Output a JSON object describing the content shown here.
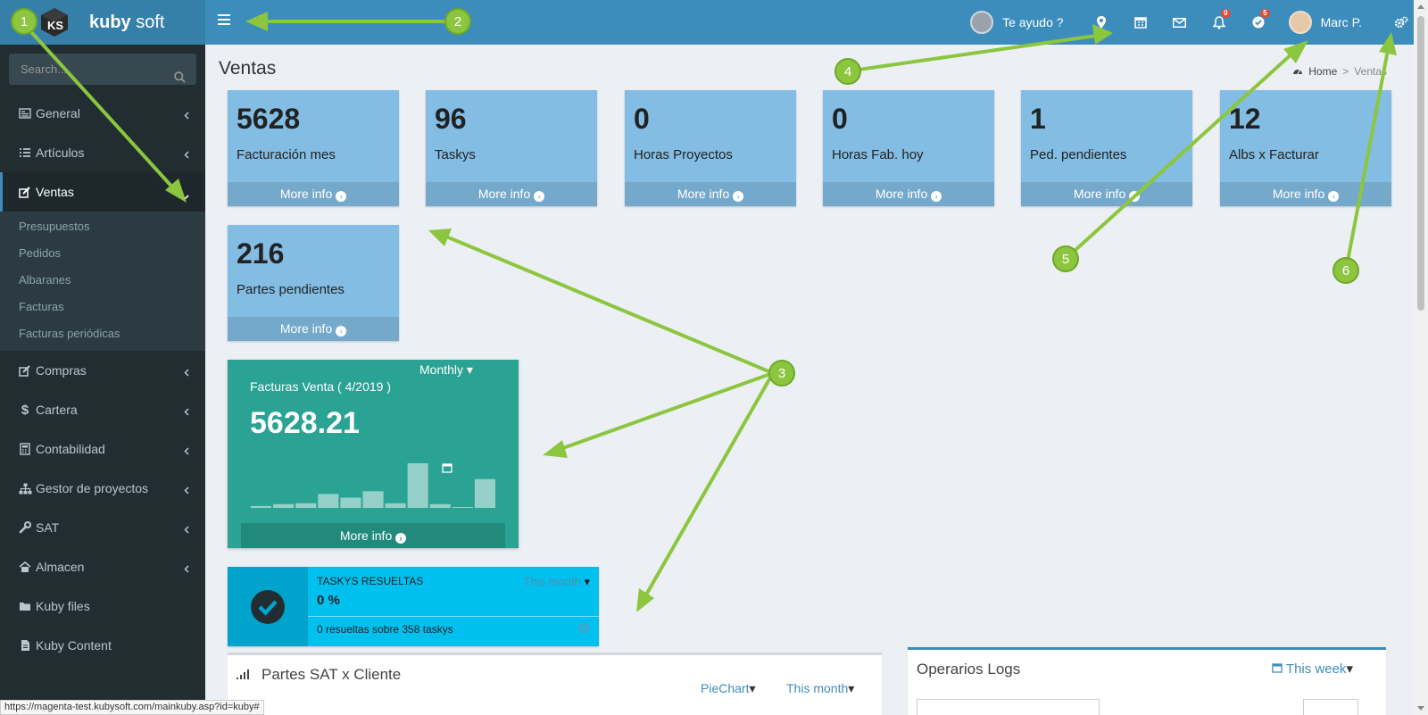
{
  "brand": {
    "name_bold": "kuby",
    "name_light": " soft",
    "logo_text": "KS"
  },
  "header": {
    "help_label": "Te ayudo ?",
    "notifications_badge": "0",
    "tasks_badge": "5",
    "user_name": "Marc P.",
    "icons": [
      "map-marker-icon",
      "calendar-icon",
      "envelope-icon",
      "bell-icon",
      "check-circle-icon",
      "gears-icon"
    ]
  },
  "sidebar": {
    "search_placeholder": "Search...",
    "items": [
      {
        "label": "General",
        "icon": "newspaper-icon"
      },
      {
        "label": "Artículos",
        "icon": "list-icon"
      },
      {
        "label": "Ventas",
        "icon": "edit-icon",
        "active": true
      },
      {
        "label": "Compras",
        "icon": "edit-icon"
      },
      {
        "label": "Cartera",
        "icon": "dollar-icon"
      },
      {
        "label": "Contabilidad",
        "icon": "calculator-icon"
      },
      {
        "label": "Gestor de proyectos",
        "icon": "sitemap-icon"
      },
      {
        "label": "SAT",
        "icon": "wrench-icon"
      },
      {
        "label": "Almacen",
        "icon": "home-icon"
      },
      {
        "label": "Kuby files",
        "icon": "folder-icon"
      },
      {
        "label": "Kuby Content",
        "icon": "file-icon"
      }
    ],
    "ventas_sub": [
      "Presupuestos",
      "Pedidos",
      "Albaranes",
      "Facturas",
      "Facturas periódicas"
    ]
  },
  "page": {
    "title": "Ventas",
    "breadcrumb_home": "Home",
    "breadcrumb_sep": ">",
    "breadcrumb_current": "Ventas"
  },
  "tiles": [
    {
      "value": "5628",
      "label": "Facturación mes",
      "more": "More info"
    },
    {
      "value": "96",
      "label": "Taskys",
      "more": "More info"
    },
    {
      "value": "0",
      "label": "Horas Proyectos",
      "more": "More info"
    },
    {
      "value": "0",
      "label": "Horas Fab. hoy",
      "more": "More info"
    },
    {
      "value": "1",
      "label": "Ped. pendientes",
      "more": "More info"
    },
    {
      "value": "12",
      "label": "Albs x Facturar",
      "more": "More info"
    },
    {
      "value": "216",
      "label": "Partes pendientes",
      "more": "More info"
    }
  ],
  "facturas": {
    "period_label": "Monthly",
    "title": "Facturas Venta ( 4/2019 )",
    "total": "5628.21",
    "more": "More info",
    "chart_data": {
      "type": "bar",
      "values": [
        2,
        4,
        5,
        15,
        11,
        18,
        5,
        48,
        4,
        1,
        31
      ],
      "title": "",
      "xlabel": "",
      "ylabel": ""
    }
  },
  "taskys_box": {
    "title": "TASKYS RESUELTAS",
    "filter": "This month",
    "percent": "0 %",
    "summary": "0 resueltas sobre 358 taskys"
  },
  "partes_panel": {
    "title": "Partes SAT x Cliente",
    "chart_type": "PieChart",
    "period": "This month"
  },
  "operarios_panel": {
    "title": "Operarios Logs",
    "period": "This week"
  },
  "status_url": "https://magenta-test.kubysoft.com/mainkuby.asp?id=kuby#",
  "annotations": [
    "1",
    "2",
    "3",
    "4",
    "5",
    "6"
  ],
  "colors": {
    "accent": "#3c8dbc",
    "tile": "#83bde3",
    "teal": "#2aa294",
    "aqua": "#00c0ef",
    "annotation": "#8cc63f"
  }
}
